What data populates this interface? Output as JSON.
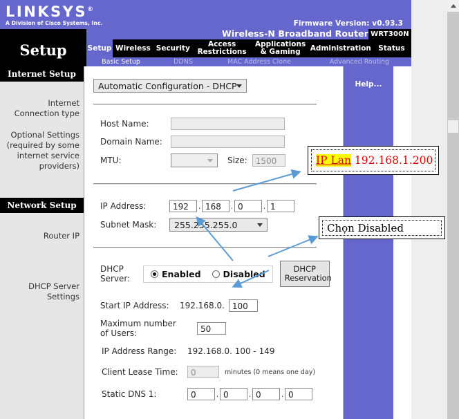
{
  "brand": {
    "name": "LINKSYS",
    "registered": "®",
    "tagline": "A Division of Cisco Systems, Inc.",
    "firmware": "Firmware Version: v0.93.3",
    "accent_color": "#6567cd"
  },
  "model": {
    "name": "Wireless-N Broadband Router",
    "code": "WRT300N"
  },
  "page": {
    "section_title": "Setup"
  },
  "nav": {
    "tabs": [
      {
        "label": "Setup",
        "active": true
      },
      {
        "label": "Wireless",
        "active": false
      },
      {
        "label": "Security",
        "active": false
      },
      {
        "label": "Access\nRestrictions",
        "active": false
      },
      {
        "label": "Applications\n& Gaming",
        "active": false
      },
      {
        "label": "Administration",
        "active": false
      },
      {
        "label": "Status",
        "active": false
      }
    ],
    "subtabs": [
      {
        "label": "Basic Setup",
        "active": true
      },
      {
        "label": "DDNS",
        "active": false
      },
      {
        "label": "MAC Address Clone",
        "active": false
      },
      {
        "label": "Advanced Routing",
        "active": false
      }
    ]
  },
  "sidebar": {
    "internet_setup_header": "Internet Setup",
    "internet_connection_type": "Internet\nConnection type",
    "optional_settings": "Optional Settings\n(required by some\ninternet service\nproviders)",
    "network_setup_header": "Network Setup",
    "router_ip": "Router IP",
    "dhcp_server_settings": "DHCP Server\nSettings"
  },
  "help": {
    "label": "Help..."
  },
  "form": {
    "connection_type": {
      "selected": "Automatic Configuration - DHCP"
    },
    "host_name": {
      "label": "Host Name:",
      "value": "",
      "placeholder": ""
    },
    "domain_name": {
      "label": "Domain Name:",
      "value": "",
      "placeholder": ""
    },
    "mtu": {
      "label": "MTU:",
      "selected": "",
      "size_label": "Size:",
      "size_value": "1500"
    },
    "ip_address": {
      "label": "IP Address:",
      "octets": [
        "192",
        "168",
        "0",
        "1"
      ]
    },
    "subnet_mask": {
      "label": "Subnet Mask:",
      "selected": "255.255.255.0"
    },
    "dhcp_server": {
      "label": "DHCP\nServer:",
      "enabled_label": "Enabled",
      "disabled_label": "Disabled",
      "selected": "Enabled",
      "reservation_button": "DHCP\nReservation"
    },
    "start_ip": {
      "label": "Start IP Address:",
      "prefix": "192.168.0.",
      "value": "100"
    },
    "max_users": {
      "label": "Maximum number\nof Users:",
      "value": "50"
    },
    "ip_range": {
      "label": "IP Address Range:",
      "value": "192.168.0. 100 - 149"
    },
    "lease_time": {
      "label": "Client Lease Time:",
      "value": "0",
      "suffix": "minutes (0 means one day)"
    },
    "static_dns1": {
      "label": "Static DNS 1:",
      "octets": [
        "0",
        "0",
        "0",
        "0"
      ]
    }
  },
  "annotations": [
    {
      "id": "ip-lan-note",
      "highlight_text": "IP Lan",
      "text": " 192.168.1.200",
      "color": "#e00000",
      "highlight_color": "#ffff00"
    },
    {
      "id": "choose-disabled-note",
      "text": "Chọn Disabled",
      "color": "#000000"
    }
  ],
  "scrollbar": {
    "up_arrow": "scroll-up",
    "position": "near-top"
  }
}
